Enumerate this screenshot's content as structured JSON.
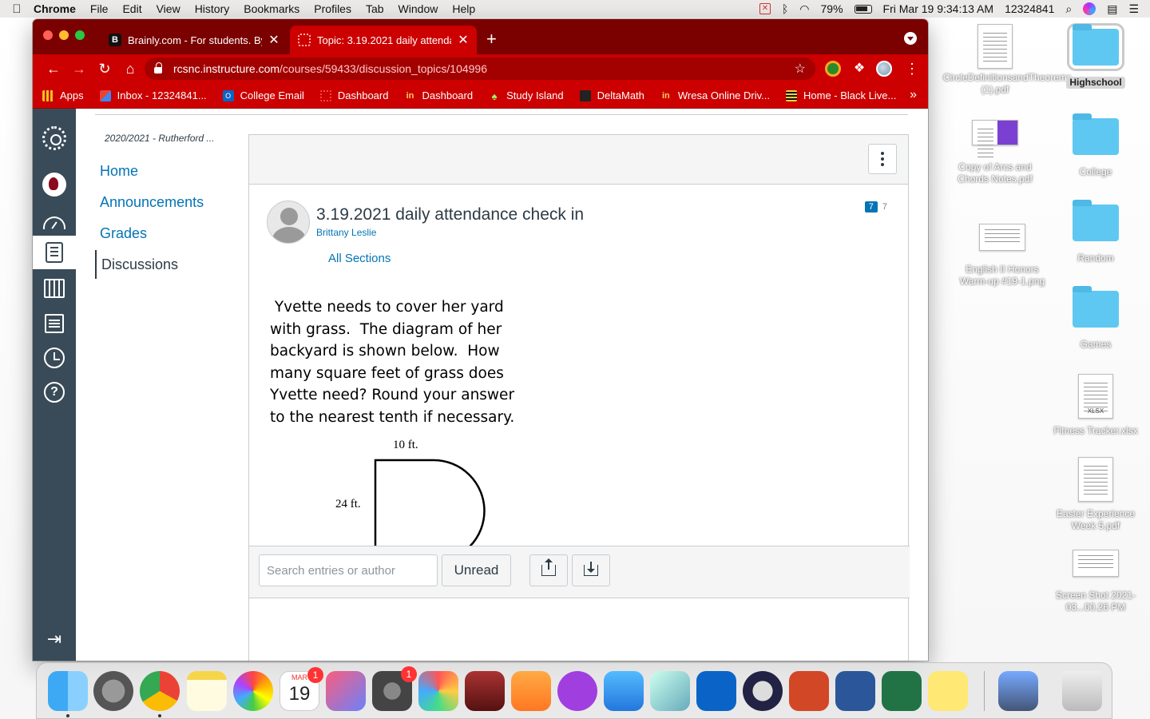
{
  "menubar": {
    "app": "Chrome",
    "menus": [
      "File",
      "Edit",
      "View",
      "History",
      "Bookmarks",
      "Profiles",
      "Tab",
      "Window",
      "Help"
    ],
    "battery": "79%",
    "clock": "Fri Mar 19  9:34:13 AM",
    "user": "12324841"
  },
  "desktop": {
    "icons": [
      {
        "label": "CircleDefinitionsandTheorems (1).pdf",
        "kind": "pdf"
      },
      {
        "label": "Highschool",
        "kind": "folder"
      },
      {
        "label": "Copy of Arcs and Chords Notes.pdf",
        "kind": "pdf"
      },
      {
        "label": "College",
        "kind": "folder"
      },
      {
        "label": "English II Honors Warm-up #19-1.png",
        "kind": "png"
      },
      {
        "label": "Random",
        "kind": "folder"
      },
      {
        "label": "Games",
        "kind": "folder"
      },
      {
        "label": "Fitness Tracker.xlsx",
        "kind": "xlsx"
      },
      {
        "label": "Easter Experience Week 5.pdf",
        "kind": "pdf"
      },
      {
        "label": "Screen Shot 2021-03...00.26 PM",
        "kind": "png"
      }
    ]
  },
  "browser": {
    "tabs": [
      {
        "title": "Brainly.com - For students. By",
        "favicon": "brainly-icon"
      },
      {
        "title": "Topic: 3.19.2021 daily attendan",
        "favicon": "canvas-icon"
      }
    ],
    "url_host": "rcsnc.instructure.com",
    "url_path": "/courses/59433/discussion_topics/104996",
    "bookmarks": [
      {
        "label": "Apps"
      },
      {
        "label": "Inbox - 12324841..."
      },
      {
        "label": "College Email"
      },
      {
        "label": "Dashboard"
      },
      {
        "label": "Dashboard"
      },
      {
        "label": "Study Island"
      },
      {
        "label": "DeltaMath"
      },
      {
        "label": "Wresa Online Driv..."
      },
      {
        "label": "Home - Black Live..."
      }
    ]
  },
  "course": {
    "term": "2020/2021 - Rutherford ...",
    "nav": [
      "Home",
      "Announcements",
      "Grades",
      "Discussions"
    ]
  },
  "discussion": {
    "title": "3.19.2021 daily attendance check in",
    "author": "Brittany Leslie",
    "sections": "All Sections",
    "unread_count": "7",
    "total_count": "7",
    "problem_lines": [
      " Yvette needs to cover her yard",
      "with grass.  The diagram of her",
      "backyard is shown below.  How",
      "many square feet of grass does",
      "Yvette need? Round your answer",
      "to the nearest tenth if necessary."
    ],
    "diagram_width_label": "10 ft.",
    "diagram_height_label": "24 ft.",
    "search_placeholder": "Search entries or author",
    "unread_button": "Unread"
  },
  "dock": {
    "calendar_month": "MAR",
    "calendar_day": "19",
    "badges": {
      "calendar": "1",
      "system_prefs": "1"
    }
  }
}
